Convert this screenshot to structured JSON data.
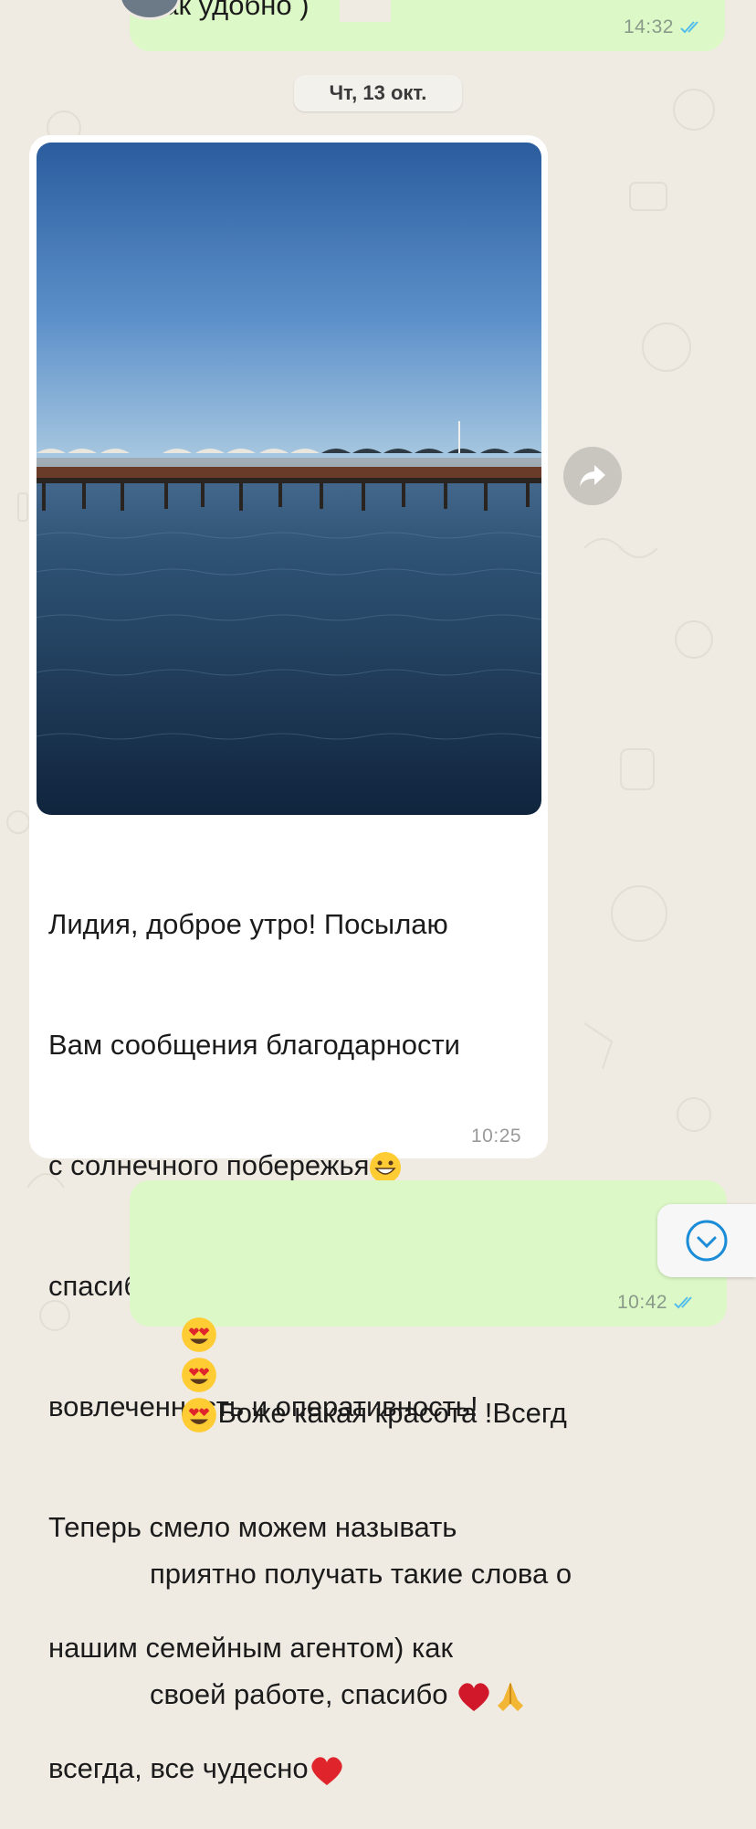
{
  "top_message": {
    "text_fragment": "как удобно )",
    "time": "14:32"
  },
  "date_separator": "Чт, 13 окт.",
  "incoming_message": {
    "lines": [
      "Лидия, доброе утро! Посылаю",
      "Вам сообщения благодарности",
      "с солнечного побережья",
      "спасибо за помощь, за",
      "вовлеченность и оперативность!",
      "Теперь смело можем называть",
      "нашим семейным агентом) как",
      "всегда, все чудесно"
    ],
    "time": "10:25"
  },
  "outgoing_message": {
    "lines": [
      "Боже какая красота !Всегд",
      "приятно получать такие слова о",
      "своей работе, спасибо"
    ],
    "time": "10:42"
  },
  "icons": {
    "forward": "forward-icon",
    "scroll_down": "chevron-down-icon",
    "read_ticks": "double-check-icon"
  },
  "colors": {
    "outgoing_bubble": "#dcf8c6",
    "read_ticks": "#53bdeb",
    "scroll_icon": "#1a8cd8"
  }
}
